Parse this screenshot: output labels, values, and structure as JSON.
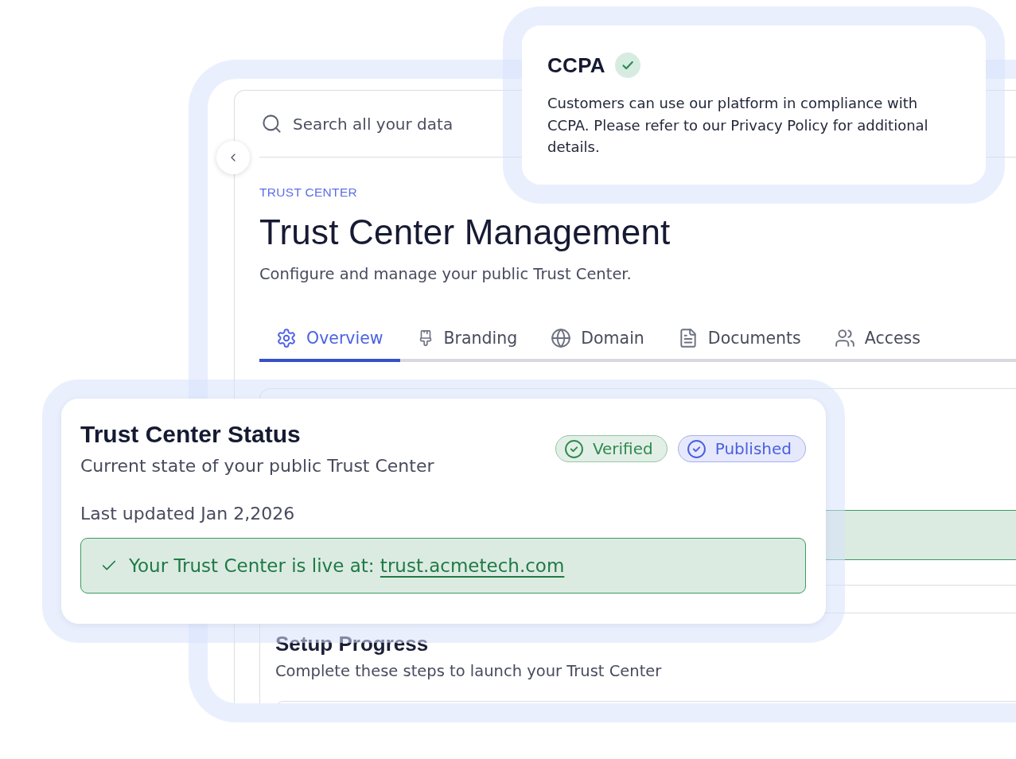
{
  "search": {
    "placeholder": "Search all your data"
  },
  "header": {
    "eyebrow": "TRUST CENTER",
    "title": "Trust Center Management",
    "subtitle": "Configure and manage your public Trust Center."
  },
  "tabs": [
    {
      "label": "Overview",
      "selected": true
    },
    {
      "label": "Branding",
      "selected": false
    },
    {
      "label": "Domain",
      "selected": false
    },
    {
      "label": "Documents",
      "selected": false
    },
    {
      "label": "Access",
      "selected": false
    }
  ],
  "setup_card": {
    "title": "Setup Progress",
    "subtitle": "Complete these steps to launch your Trust Center"
  },
  "status_card": {
    "title": "Trust Center Status",
    "subtitle": "Current state of your public Trust Center",
    "badges": [
      {
        "label": "Verified",
        "color": "#2f8a4f"
      },
      {
        "label": "Published",
        "color": "#4a5fe0"
      }
    ],
    "last_updated": "Last updated Jan 2,2026",
    "banner": {
      "text": "Your Trust Center is live at:",
      "link": "trust.acmetech.com"
    }
  },
  "ccpa_card": {
    "title": "CCPA",
    "verified": true,
    "text": "Customers can use our platform in compliance with CCPA. Please refer to our Privacy Policy for additional details."
  }
}
